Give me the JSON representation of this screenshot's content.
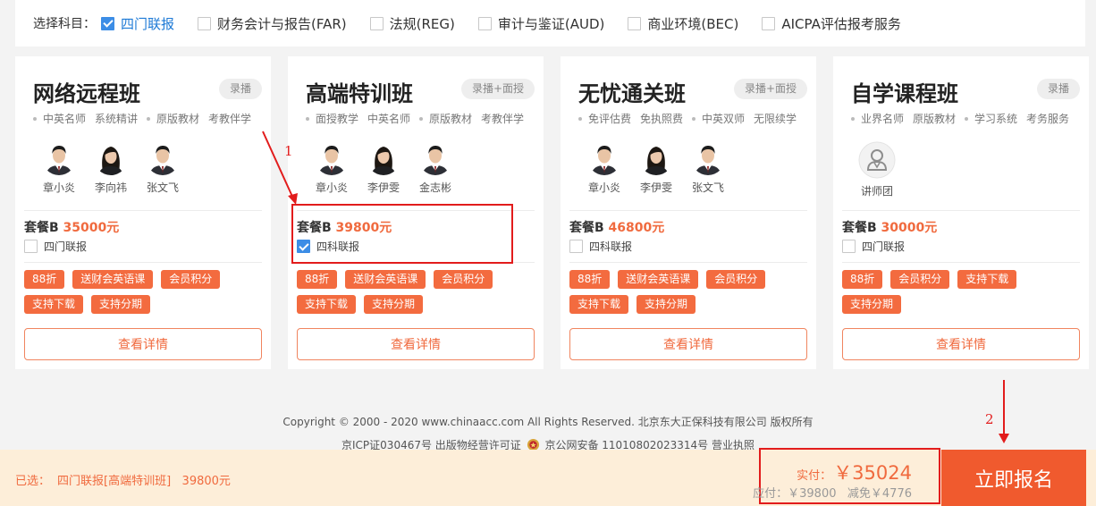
{
  "subjects": {
    "label": "选择科目：",
    "items": [
      {
        "name": "四门联报",
        "checked": true
      },
      {
        "name": "财务会计与报告(FAR)",
        "checked": false
      },
      {
        "name": "法规(REG)",
        "checked": false
      },
      {
        "name": "审计与鉴证(AUD)",
        "checked": false
      },
      {
        "name": "商业环境(BEC)",
        "checked": false
      },
      {
        "name": "AICPA评估报考服务",
        "checked": false
      }
    ]
  },
  "cards": [
    {
      "title": "网络远程班",
      "tag": "录播",
      "features": [
        "中英名师",
        "系统精讲",
        "原版教材",
        "考教伴学"
      ],
      "teachers": [
        "章小炎",
        "李向祎",
        "张文飞"
      ],
      "package_label": "套餐B",
      "price": "35000元",
      "combo": "四门联报",
      "combo_checked": false,
      "badges": [
        "88折",
        "送财会英语课",
        "会员积分",
        "支持下载",
        "支持分期"
      ],
      "detail_label": "查看详情"
    },
    {
      "title": "高端特训班",
      "tag": "录播+面授",
      "features": [
        "面授教学",
        "中英名师",
        "原版教材",
        "考教伴学"
      ],
      "teachers": [
        "章小炎",
        "李伊雯",
        "金志彬"
      ],
      "package_label": "套餐B",
      "price": "39800元",
      "combo": "四科联报",
      "combo_checked": true,
      "badges": [
        "88折",
        "送财会英语课",
        "会员积分",
        "支持下载",
        "支持分期"
      ],
      "detail_label": "查看详情"
    },
    {
      "title": "无忧通关班",
      "tag": "录播+面授",
      "features": [
        "免评估费",
        "免执照费",
        "中英双师",
        "无限续学"
      ],
      "teachers": [
        "章小炎",
        "李伊雯",
        "张文飞"
      ],
      "package_label": "套餐B",
      "price": "46800元",
      "combo": "四科联报",
      "combo_checked": false,
      "badges": [
        "88折",
        "送财会英语课",
        "会员积分",
        "支持下载",
        "支持分期"
      ],
      "detail_label": "查看详情"
    },
    {
      "title": "自学课程班",
      "tag": "录播",
      "features": [
        "业界名师",
        "原版教材",
        "学习系统",
        "考务服务"
      ],
      "teachers": [
        "讲师团"
      ],
      "package_label": "套餐B",
      "price": "30000元",
      "combo": "四门联报",
      "combo_checked": false,
      "badges": [
        "88折",
        "会员积分",
        "支持下载",
        "支持分期"
      ],
      "detail_label": "查看详情"
    }
  ],
  "annotations": {
    "one": "1",
    "two": "2"
  },
  "footer": {
    "copyright": "Copyright © 2000 - 2020 www.chinaacc.com All Rights Reserved. 北京东大正保科技有限公司 版权所有",
    "icp": "京ICP证030467号 出版物经营许可证",
    "police": "京公网安备 11010802023314号 营业执照"
  },
  "bottom": {
    "selected_prefix": "已选：",
    "selected_value": "四门联报[高端特训班]   39800元",
    "actual_label": "实付：",
    "actual_amount": "￥35024",
    "payable": "应付：￥39800",
    "discount": "减免￥4776",
    "enroll_label": "立即报名"
  },
  "colors": {
    "accent": "#f06a3e",
    "blue": "#1e7ad6",
    "annotation_red": "#e21c1c"
  }
}
